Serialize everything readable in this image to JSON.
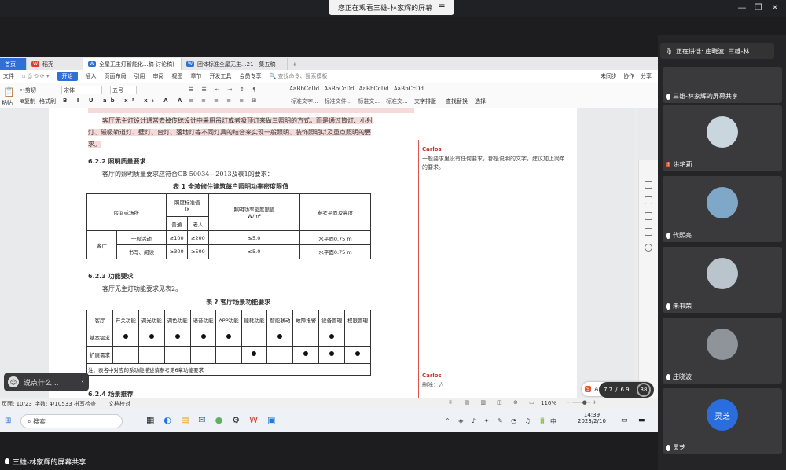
{
  "meeting": {
    "share_banner": "您正在观看三雄-林家辉的屏幕",
    "speaking_label": "正在讲话: 庄晓波; 三雄-林...",
    "bottom_label": "三雄-林家辉的屏幕共享",
    "chat_placeholder": "说点什么...",
    "participants": [
      {
        "name": "三雄-林家辉的屏幕共享"
      },
      {
        "name": "洪艳莉"
      },
      {
        "name": "代熙亮"
      },
      {
        "name": "朱书荣"
      },
      {
        "name": "庄晓波"
      },
      {
        "name": "灵芝",
        "avatar_text": "灵芝"
      }
    ]
  },
  "wps": {
    "tabs": [
      {
        "label": "首页"
      },
      {
        "label": "稻壳"
      },
      {
        "label": "全屋无主灯智能化...稿-讨论稿)"
      },
      {
        "label": "团体标准全屋无主...21一集五稿"
      },
      {
        "label": "+"
      }
    ],
    "menu": [
      "文件",
      "开始",
      "插入",
      "页面布局",
      "引用",
      "审阅",
      "视图",
      "章节",
      "开发工具",
      "会员专享"
    ],
    "search_placeholder": "查找命令、搜索模板",
    "top_right": [
      "未同步",
      "协作",
      "分享"
    ],
    "ribbon": {
      "paste": "粘贴",
      "cut": "剪切",
      "copy": "复制",
      "format_painter": "格式刷",
      "font_name": "宋体",
      "font_size": "五号",
      "styles": [
        "AaBbCcDd",
        "AaBbCcDd",
        "AaBbCcDd",
        "AaBbCcDd"
      ],
      "style_names": [
        "标准文字...",
        "标准文件...",
        "标准文...",
        "标准文..."
      ],
      "text_layout": "文字排版",
      "find_replace": "查找替换",
      "select": "选择"
    },
    "status": {
      "page": "页面: 10/23",
      "words": "字数: 4/10533",
      "spell": "拼写检查",
      "proof": "文档校对",
      "zoom": "116%"
    }
  },
  "doc": {
    "para_highlight_1": "客厅无主灯设计通常去掉传统设计中采用吊灯或者吸顶灯来做三照明的方式，而是通过筒灯、小射",
    "para_highlight_2": "灯、磁吸轨道灯、壁灯、台灯、落地灯等不同灯具的结合来实现一般照明、装饰照明以及重点照明的要",
    "para_highlight_3": "求。",
    "h_622": "6.2.2  照明质量要求",
    "p_622": "客厅的照明质量要求应符合GB 50034—2013及表1的要求：",
    "t1_title": "表 1   全装修住建筑每户照明功率密度限值",
    "t1": {
      "col_room": "房间或场所",
      "col_std": "照度标准值",
      "col_lx": "lx",
      "col_common": "普通",
      "col_elderly": "老人",
      "col_density": "照明功率密度限值",
      "col_density_unit": "W/m²",
      "col_ref": "参考平面及高度",
      "row_room": "客厅",
      "rows": [
        {
          "scene": "一般活动",
          "common": "≥100",
          "elderly": "≥200",
          "density": "≤5.0",
          "ref": "水平面0.75 m"
        },
        {
          "scene": "书写、阅读",
          "common": "≥300",
          "elderly": "≥500",
          "density": "≤5.0",
          "ref": "水平面0.75 m"
        }
      ]
    },
    "h_623": "6.2.3  功能要求",
    "p_623": "客厅无主灯功能要求见表2。",
    "t2_title": "表 ?  客厅场景功能要求",
    "t2": {
      "headers": [
        "客厅",
        "开关功能",
        "调光功能",
        "调色功能",
        "语音功能",
        "APP功能",
        "能耗功能",
        "智能联动",
        "故障报警",
        "设备管理",
        "权限管理"
      ],
      "row_basic": "基本需求",
      "row_ext": "扩展需求",
      "basic_marks": [
        true,
        true,
        true,
        true,
        true,
        false,
        true,
        false,
        true,
        false
      ],
      "ext_marks": [
        false,
        false,
        false,
        false,
        false,
        true,
        false,
        true,
        true,
        true
      ],
      "note": "注：表名中对应的系功能描述请参考第6章功能要求"
    },
    "h_624": "6.2.4  场景推荐"
  },
  "comments": [
    {
      "author": "Carlos",
      "text": "一般要求里没有任何要求，都是说明的文字，建议加上简单的要求。"
    },
    {
      "author": "Carlos",
      "text": "删除：六"
    }
  ],
  "taskbar": {
    "search": "搜索",
    "time": "14:39",
    "date": "2023/2/10",
    "lang": "中",
    "network_up": "7.7",
    "network_down": "6.9",
    "battery_pct": "38"
  },
  "colors": {
    "accent": "#2f6fd6",
    "comment_author": "#c0392b",
    "highlight": "#f6d9d9"
  }
}
